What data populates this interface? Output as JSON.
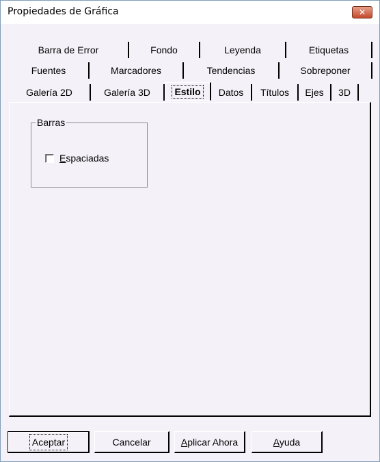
{
  "window": {
    "title": "Propiedades de Gráfica"
  },
  "tabs": {
    "row1": [
      "Barra de Error",
      "Fondo",
      "Leyenda",
      "Etiquetas"
    ],
    "row2": [
      "Fuentes",
      "Marcadores",
      "Tendencias",
      "Sobreponer"
    ],
    "row3": [
      "Galería 2D",
      "Galería 3D",
      "Estilo",
      "Datos",
      "Títulos",
      "Ejes",
      "3D"
    ],
    "active": "Estilo"
  },
  "panel": {
    "group_label": "Barras",
    "checkbox_label": "Espaciadas",
    "checkbox_checked": false
  },
  "buttons": {
    "accept": "Aceptar",
    "cancel": "Cancelar",
    "apply": "Aplicar Ahora",
    "help": "Ayuda"
  }
}
